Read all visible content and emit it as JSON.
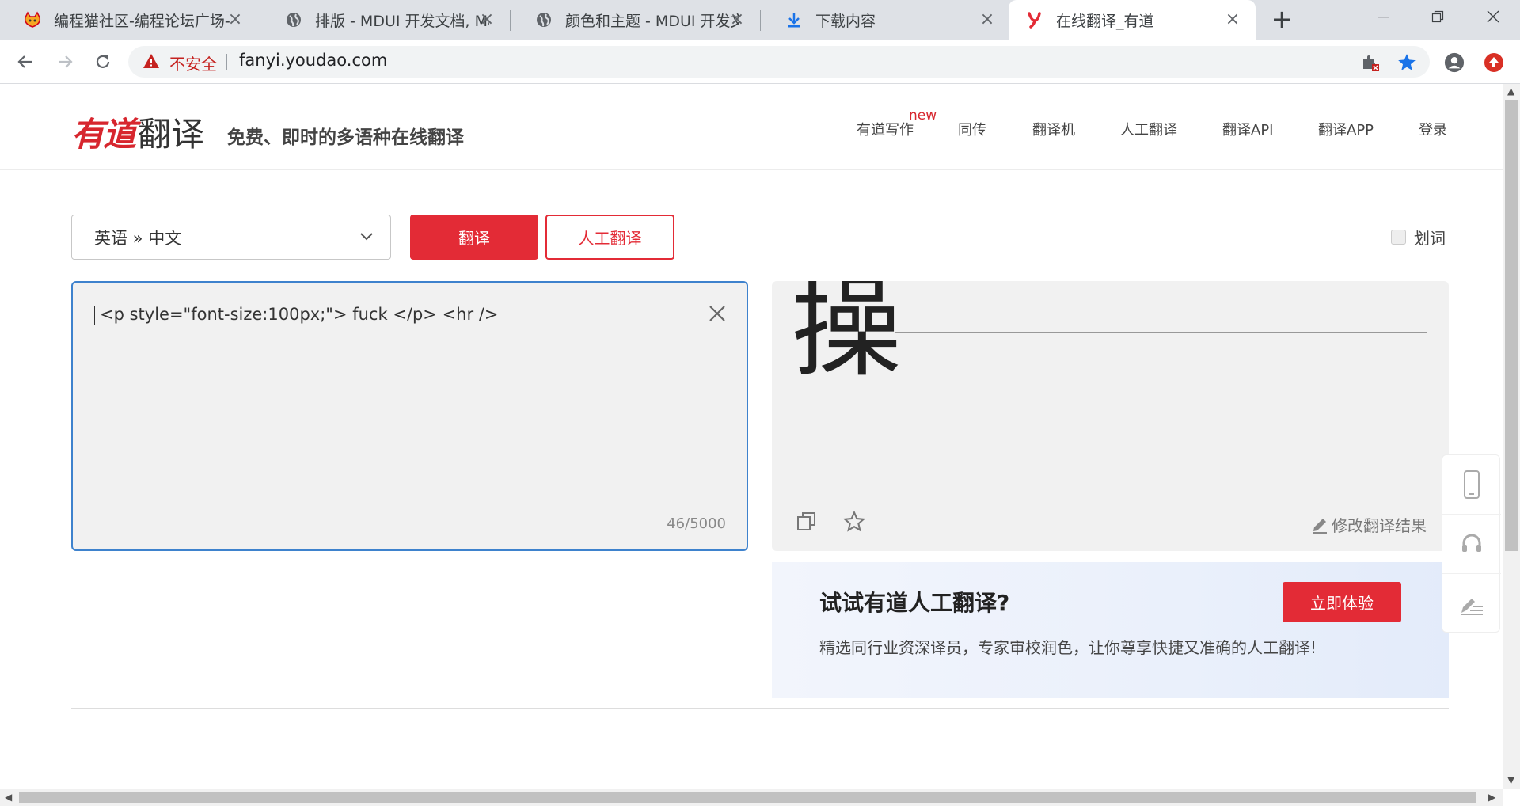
{
  "browser": {
    "tabs": [
      {
        "title": "编程猫社区-编程论坛广场-",
        "icon": "bcm-cat-icon",
        "active": false
      },
      {
        "title": "排版 - MDUI 开发文档, Ma",
        "icon": "globe-icon",
        "active": false
      },
      {
        "title": "颜色和主题 - MDUI 开发文",
        "icon": "globe-icon",
        "active": false
      },
      {
        "title": "下载内容",
        "icon": "download-icon",
        "active": false
      },
      {
        "title": "在线翻译_有道",
        "icon": "youdao-icon",
        "active": true
      }
    ],
    "address": {
      "security": "不安全",
      "url": "fanyi.youdao.com"
    },
    "colors": {
      "tabbar": "#dee1e6",
      "insecure": "#c5221f",
      "bookmark": "#1a73e8"
    }
  },
  "site": {
    "logo": {
      "brand": "有道",
      "product": "翻译"
    },
    "slogan": "免费、即时的多语种在线翻译",
    "nav": [
      {
        "label": "有道写作"
      },
      {
        "label": "同传"
      },
      {
        "label": "翻译机"
      },
      {
        "label": "人工翻译"
      },
      {
        "label": "翻译API"
      },
      {
        "label": "翻译APP"
      },
      {
        "label": "登录"
      }
    ],
    "new_badge": "new",
    "accent": "#e32b36"
  },
  "translator": {
    "lang_select": "英语 » 中文",
    "translate_btn": "翻译",
    "human_btn": "人工翻译",
    "huaci_label": "划词",
    "input_text": "<p style=\"font-size:100px;\"> fuck </p> <hr />",
    "char_count": "46/5000",
    "output_text": "操",
    "edit_result": "修改翻译结果"
  },
  "promo": {
    "heading": "试试有道人工翻译?",
    "body": "精选同行业资深译员，专家审校润色，让你尊享快捷又准确的人工翻译!",
    "cta": "立即体验"
  }
}
